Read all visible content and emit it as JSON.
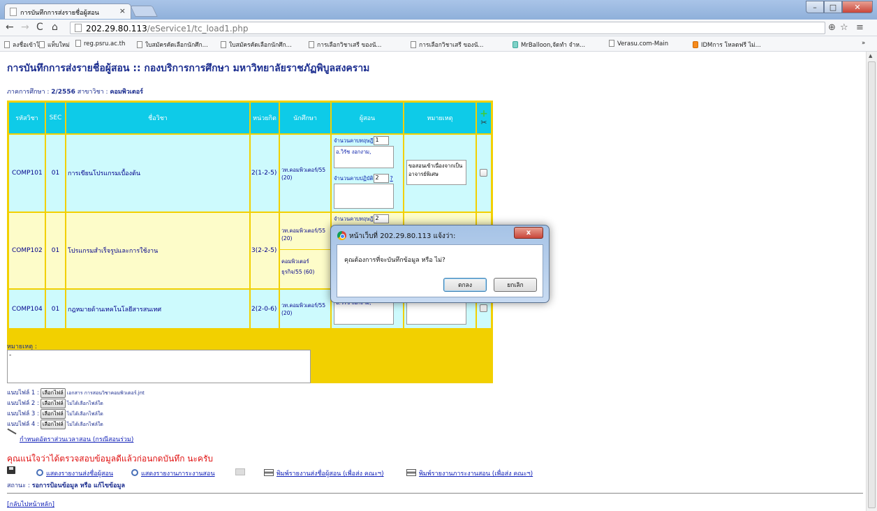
{
  "browser": {
    "tab_title": "การบันทึกการส่งรายชื่อผู้สอน",
    "url_host": "202.29.80.113",
    "url_path": "/eService1/tc_load1.php",
    "bookmarks": [
      "ลงชื่อเข้าใช้",
      "แท็บใหม่",
      "reg.psru.ac.th",
      "ใบสมัครคัดเลือกนักศึก...",
      "ใบสมัครคัดเลือกนักศึก...",
      "การเลือกวิชาเสรี ของนั...",
      "การเลือกวิชาเสรี ของนั...",
      "MrBalloon,จัดทำ จำห...",
      "Verasu.com-Main",
      "IDMการ โหลดฟรี ไม่..."
    ],
    "bookmarks_more": "»"
  },
  "page": {
    "title": "การบันทึกการส่งรายชื่อผู้สอน :: กองบริการการศึกษา มหาวิทยาลัยราชภัฏพิบูลสงคราม",
    "semester_label": "ภาคการศึกษา : ",
    "semester_value": "2/2556",
    "major_label": " สาขาวิชา : ",
    "major_value": "คอมพิวเตอร์"
  },
  "table": {
    "headers": [
      "รหัสวิชา",
      "SEC",
      "ชื่อวิชา",
      "หน่วยกิต",
      "นักศึกษา",
      "ผู้สอน",
      "หมายเหตุ"
    ],
    "theory_label": "จำนวนคาบทฤษฎี",
    "practice_label": "จำนวนคาบปฏิบัติ",
    "rows": [
      {
        "code": "COMP101",
        "sec": "01",
        "name": "การเขียนโปรแกรมเบื้องต้น",
        "credit": "2(1-2-5)",
        "students": "วท.คอมพิวเตอร์/55 (20)",
        "theory": "1",
        "teacher": "อ.วิรัช งอกงาม,",
        "practice": "2",
        "practice_mark": "?",
        "note": "ขอสอนเข้าเนื่องจากเป็นอาจารย์พิเศษ"
      },
      {
        "code": "COMP102",
        "sec": "01",
        "name": "โปรแกรมสำเร็จรูปและการใช้งาน",
        "credit": "3(2-2-5)",
        "students": "วท.คอมพิวเตอร์/55 (20)",
        "students2": "คอมพิวเตอร์ ธุรกิจ/55 (60)",
        "theory": "2"
      },
      {
        "code": "COMP104",
        "sec": "01",
        "name": "กฎหมายด้านเทคโนโลยีสารสนเทศ",
        "credit": "2(2-0-6)",
        "students": "วท.คอมพิวเตอร์/55 (20)",
        "teacher": "อ.วิรัช งอกงาม,"
      }
    ]
  },
  "remarks": {
    "label": "หมายเหตุ :",
    "value": "-"
  },
  "attachments": [
    {
      "label": "แนบไฟล์ 1 :",
      "button": "เลือกไฟล์",
      "file": "เอกสาร การสอนวิชาคอมพิวเตอร์.jnt"
    },
    {
      "label": "แนบไฟล์ 2 :",
      "button": "เลือกไฟล์",
      "file": "ไม่ได้เลือกไฟล์ใด"
    },
    {
      "label": "แนบไฟล์ 3 :",
      "button": "เลือกไฟล์",
      "file": "ไม่ได้เลือกไฟล์ใด"
    },
    {
      "label": "แนบไฟล์ 4 :",
      "button": "เลือกไฟล์",
      "file": "ไม่ได้เลือกไฟล์ใด"
    }
  ],
  "links": {
    "ratio": "กำหนดอัตราส่วนเวลาสอน (กรณีสอนร่วม)",
    "warning": "คุณแน่ใจว่าได้ตรวจสอบข้อมูลดีแล้วก่อนกดบันทึก นะครับ",
    "show_list": "แสดงรายงานส่งชื่อผู้สอน",
    "show_load": "แสดงรายงานภาระงานสอน",
    "print_list": "พิมพ์รายงานส่งชื่อผู้สอน (เพื่อส่ง คณะฯ)",
    "print_load": "พิมพ์รายงานภาระงานสอน (เพื่อส่ง คณะฯ)",
    "status_label": "สถานะ : ",
    "status_value": "รอการป้อนข้อมูล หรือ แก้ไขข้อมูล",
    "back": "[กลับไปหน้าหลัก]"
  },
  "dialog": {
    "title": "หน้าเว็บที่ 202.29.80.113 แจ้งว่า:",
    "message": "คุณต้องการที่จะบันทึกข้อมูล หรือ ไม่?",
    "ok": "ตกลง",
    "cancel": "ยกเลิก",
    "close": "x"
  }
}
